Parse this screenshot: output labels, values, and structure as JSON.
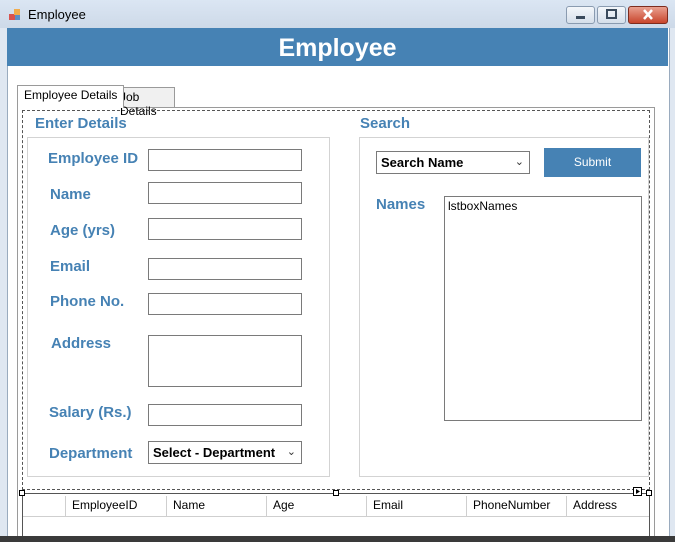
{
  "window": {
    "title": "Employee"
  },
  "header": {
    "title": "Employee"
  },
  "tabs": [
    {
      "label": "Employee Details",
      "active": true
    },
    {
      "label": "Job Details",
      "active": false
    }
  ],
  "enter_details": {
    "heading": "Enter Details",
    "fields": {
      "employee_id": {
        "label": "Employee ID",
        "value": ""
      },
      "name": {
        "label": "Name",
        "value": ""
      },
      "age": {
        "label": "Age (yrs)",
        "value": ""
      },
      "email": {
        "label": "Email",
        "value": ""
      },
      "phone": {
        "label": "Phone No.",
        "value": ""
      },
      "address": {
        "label": "Address",
        "value": ""
      },
      "salary": {
        "label": "Salary (Rs.)",
        "value": ""
      },
      "department": {
        "label": "Department",
        "selected": "Select - Department"
      }
    }
  },
  "search": {
    "heading": "Search",
    "dropdown_selected": "Search Name",
    "submit_label": "Submit",
    "names_label": "Names",
    "listbox_text": "lstboxNames"
  },
  "grid": {
    "columns": [
      "EmployeeID",
      "Name",
      "Age",
      "Email",
      "PhoneNumber",
      "Address"
    ]
  },
  "colors": {
    "accent": "#4682b4"
  }
}
